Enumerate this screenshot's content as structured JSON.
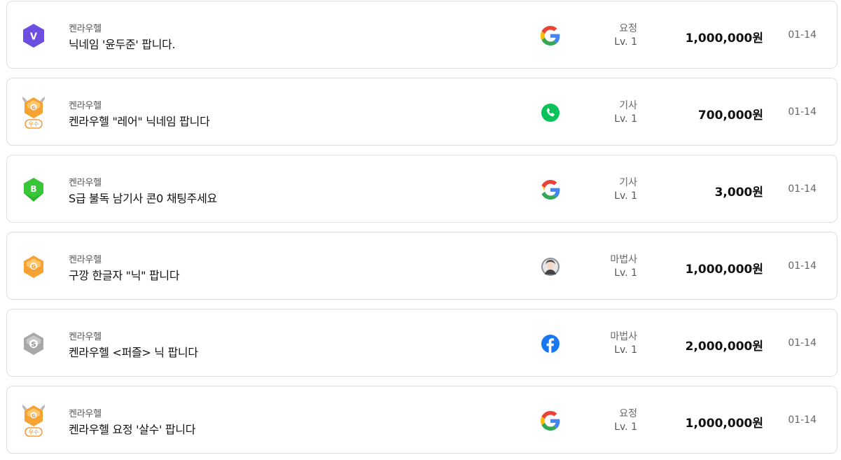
{
  "listings": [
    {
      "server": "켄라우헬",
      "title": "닉네임 '윤두준' 팝니다.",
      "job": "요정",
      "level": "Lv. 1",
      "price": "1,000,000원",
      "date": "01-14",
      "badge": "v-rank-icon",
      "login": "google-icon"
    },
    {
      "server": "켄라우헬",
      "title": "켄라우헬 \"레어\" 닉네임 팝니다",
      "job": "기사",
      "level": "Lv. 1",
      "price": "700,000원",
      "date": "01-14",
      "badge": "excellent-seller-icon",
      "badge_text": "우수",
      "login": "phone-icon"
    },
    {
      "server": "켄라우헬",
      "title": "S급 불독 남기사 콘0 채팅주세요",
      "job": "기사",
      "level": "Lv. 1",
      "price": "3,000원",
      "date": "01-14",
      "badge": "b-rank-icon",
      "login": "google-icon"
    },
    {
      "server": "켄라우헬",
      "title": "구깡 한글자 \"닉\" 팝니다",
      "job": "마법사",
      "level": "Lv. 1",
      "price": "1,000,000원",
      "date": "01-14",
      "badge": "g-rank-icon",
      "login": "avatar-icon"
    },
    {
      "server": "켄라우헬",
      "title": "켄라우헬 <퍼즐> 닉 팝니다",
      "job": "마법사",
      "level": "Lv. 1",
      "price": "2,000,000원",
      "date": "01-14",
      "badge": "s-rank-icon",
      "login": "facebook-icon"
    },
    {
      "server": "켄라우헬",
      "title": "켄라우헬 요정 '살수' 팝니다",
      "job": "요정",
      "level": "Lv. 1",
      "price": "1,000,000원",
      "date": "01-14",
      "badge": "excellent-seller-icon",
      "badge_text": "우수",
      "login": "google-icon"
    }
  ],
  "colors": {
    "v_rank": "#6c4fe0",
    "b_rank": "#2fb42f",
    "g_rank": "#f7a334",
    "s_rank": "#a8a8a8",
    "google_blue": "#4285F4",
    "google_red": "#EA4335",
    "google_yellow": "#FBBC05",
    "google_green": "#34A853",
    "phone_green": "#07c35a",
    "facebook_blue": "#1877F2",
    "border": "#dcdfe5"
  }
}
